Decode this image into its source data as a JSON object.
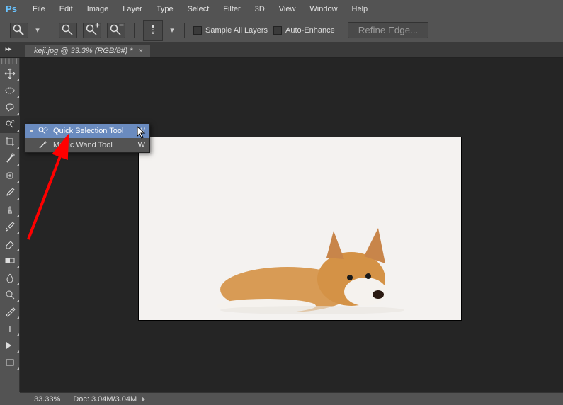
{
  "menu": {
    "items": [
      "File",
      "Edit",
      "Image",
      "Layer",
      "Type",
      "Select",
      "Filter",
      "3D",
      "View",
      "Window",
      "Help"
    ]
  },
  "options": {
    "sample_all_label": "Sample All Layers",
    "auto_enhance_label": "Auto-Enhance",
    "refine_label": "Refine Edge...",
    "brush_size": "9"
  },
  "document": {
    "tab_title": "keji.jpg @ 33.3% (RGB/8#) *"
  },
  "flyout": {
    "items": [
      {
        "label": "Quick Selection Tool",
        "shortcut": "W",
        "selected": true,
        "icon": "quick-selection-icon"
      },
      {
        "label": "Magic Wand Tool",
        "shortcut": "W",
        "selected": false,
        "icon": "magic-wand-icon"
      }
    ]
  },
  "status": {
    "zoom": "33.33%",
    "doc_info": "Doc: 3.04M/3.04M"
  },
  "tools": [
    {
      "name": "move-tool",
      "icon": "move"
    },
    {
      "name": "marquee-tool",
      "icon": "marquee"
    },
    {
      "name": "lasso-tool",
      "icon": "lasso"
    },
    {
      "name": "quick-selection-tool",
      "icon": "qsel",
      "active": true
    },
    {
      "name": "crop-tool",
      "icon": "crop"
    },
    {
      "name": "eyedropper-tool",
      "icon": "eye"
    },
    {
      "name": "healing-brush-tool",
      "icon": "heal"
    },
    {
      "name": "brush-tool",
      "icon": "brush"
    },
    {
      "name": "clone-stamp-tool",
      "icon": "stamp"
    },
    {
      "name": "history-brush-tool",
      "icon": "hist"
    },
    {
      "name": "eraser-tool",
      "icon": "eraser"
    },
    {
      "name": "gradient-tool",
      "icon": "grad"
    },
    {
      "name": "blur-tool",
      "icon": "blur"
    },
    {
      "name": "dodge-tool",
      "icon": "dodge"
    },
    {
      "name": "pen-tool",
      "icon": "pen"
    },
    {
      "name": "type-tool",
      "icon": "type"
    },
    {
      "name": "path-selection-tool",
      "icon": "path"
    },
    {
      "name": "rectangle-tool",
      "icon": "rect"
    }
  ]
}
